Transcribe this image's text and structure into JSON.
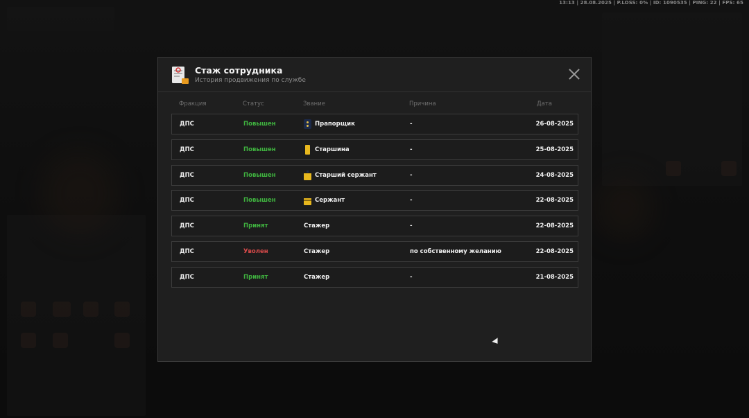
{
  "hud": {
    "text": "13:13 | 28.08.2025 | P.LOSS: 0% | ID: 1090535 | PING: 22 | FPS: 65"
  },
  "modal": {
    "title": "Стаж сотрудника",
    "subtitle": "История продвижения по службе",
    "icon": "document-icon",
    "close_icon": "close-icon"
  },
  "table": {
    "columns": [
      "Фракция",
      "Статус",
      "Звание",
      "Причина",
      "Дата"
    ],
    "rows": [
      {
        "faction": "ДПС",
        "status": "Повышен",
        "status_type": "up",
        "rank": "Прапорщик",
        "rank_icon": "praporshchik-insignia-icon",
        "reason": "-",
        "date": "26-08-2025"
      },
      {
        "faction": "ДПС",
        "status": "Повышен",
        "status_type": "up",
        "rank": "Старшина",
        "rank_icon": "starshina-insignia-icon",
        "reason": "-",
        "date": "25-08-2025"
      },
      {
        "faction": "ДПС",
        "status": "Повышен",
        "status_type": "up",
        "rank": "Старший сержант",
        "rank_icon": "senior-sergeant-insignia-icon",
        "reason": "-",
        "date": "24-08-2025"
      },
      {
        "faction": "ДПС",
        "status": "Повышен",
        "status_type": "up",
        "rank": "Сержант",
        "rank_icon": "sergeant-insignia-icon",
        "reason": "-",
        "date": "22-08-2025"
      },
      {
        "faction": "ДПС",
        "status": "Принят",
        "status_type": "accepted",
        "rank": "Стажер",
        "rank_icon": "",
        "reason": "-",
        "date": "22-08-2025"
      },
      {
        "faction": "ДПС",
        "status": "Уволен",
        "status_type": "fired",
        "rank": "Стажер",
        "rank_icon": "",
        "reason": "по собственному желанию",
        "date": "22-08-2025"
      },
      {
        "faction": "ДПС",
        "status": "Принят",
        "status_type": "accepted",
        "rank": "Стажер",
        "rank_icon": "",
        "reason": "-",
        "date": "21-08-2025"
      }
    ]
  },
  "colors": {
    "status_up": "#3fb23f",
    "status_accepted": "#3fb23f",
    "status_fired": "#d84a4a",
    "modal_bg": "#1f1f1f",
    "row_border": "#3c3c3c"
  }
}
